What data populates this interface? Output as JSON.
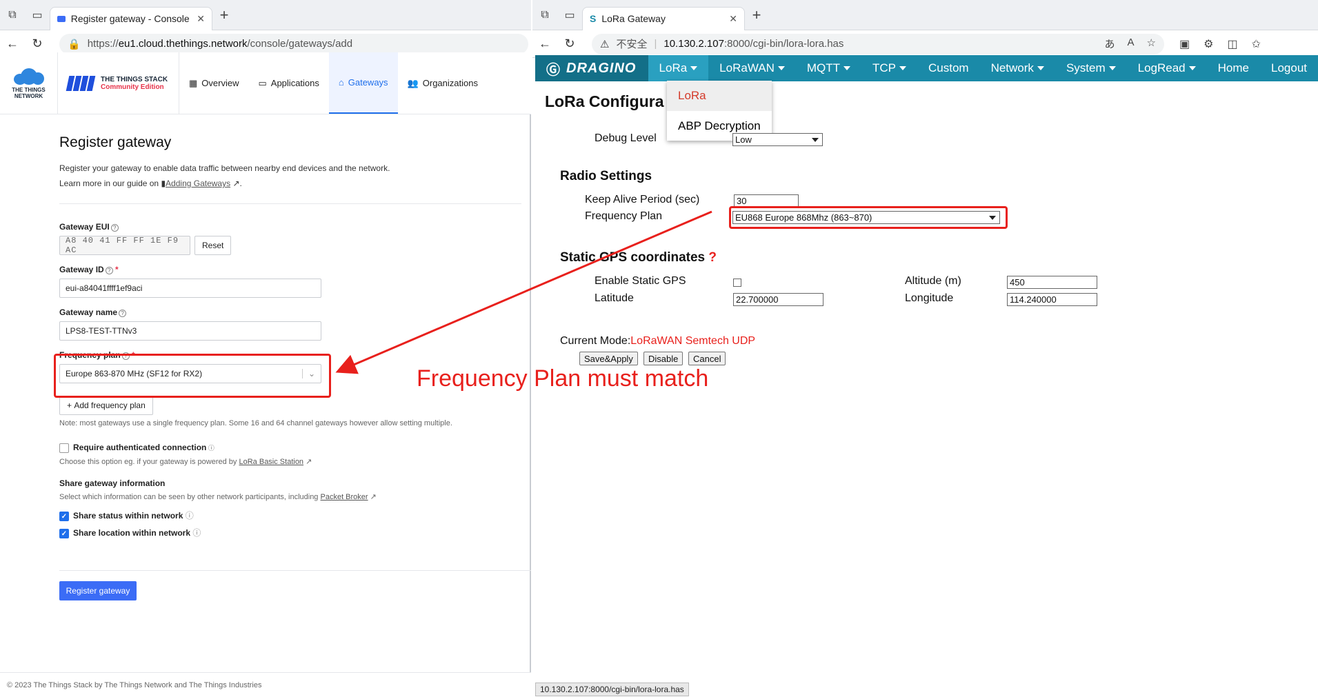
{
  "left_browser": {
    "tab_title": "Register gateway - Console - The",
    "url_prefix": "https://",
    "url_host": "eu1.cloud.thethings.network",
    "url_path": "/console/gateways/add"
  },
  "ttn": {
    "logo_text": "THE THINGS NETWORK",
    "stack_title": "THE THINGS STACK",
    "stack_edition": "Community Edition",
    "nav": [
      "Overview",
      "Applications",
      "Gateways",
      "Organizations"
    ],
    "page_title": "Register gateway",
    "intro": "Register your gateway to enable data traffic between nearby end devices and the network.",
    "learn_more": "Learn more in our guide on",
    "guide_link": "Adding Gateways",
    "eui_label": "Gateway EUI",
    "eui_value": "A8 40 41 FF FF 1E F9 AC",
    "reset_label": "Reset",
    "id_label": "Gateway ID",
    "id_value": "eui-a84041ffff1ef9aci",
    "name_label": "Gateway name",
    "name_value": "LPS8-TEST-TTNv3",
    "freq_label": "Frequency plan",
    "freq_value": "Europe 863-870 MHz (SF12 for RX2)",
    "add_freq": "Add frequency plan",
    "freq_note": "Note: most gateways use a single frequency plan. Some 16 and 64 channel gateways however allow setting multiple.",
    "auth_label": "Require authenticated connection",
    "auth_note": "Choose this option eg. if your gateway is powered by",
    "auth_link": "LoRa Basic Station",
    "share_title": "Share gateway information",
    "share_note": "Select which information can be seen by other network participants, including",
    "share_link": "Packet Broker",
    "share_status": "Share status within network",
    "share_location": "Share location within network",
    "register_button": "Register gateway",
    "footer": "© 2023 The Things Stack by The Things Network and The Things Industries"
  },
  "right_browser": {
    "tab_title": "LoRa Gateway",
    "insecure": "不安全",
    "url_host": "10.130.2.107",
    "url_rest": ":8000/cgi-bin/lora-lora.has",
    "status_url": "10.130.2.107:8000/cgi-bin/lora-lora.has"
  },
  "dragino": {
    "brand": "DRAGINO",
    "menu": [
      "LoRa",
      "LoRaWAN",
      "MQTT",
      "TCP",
      "Custom",
      "Network",
      "System",
      "LogRead",
      "Home",
      "Logout"
    ],
    "dropdown": [
      "LoRa",
      "ABP Decryption"
    ],
    "page_title": "LoRa Configura",
    "debug_label": "Debug Level",
    "debug_value": "Low",
    "radio_title": "Radio Settings",
    "keepalive_label": "Keep Alive Period (sec)",
    "keepalive_value": "30",
    "freqplan_label": "Frequency Plan",
    "freqplan_value": "EU868 Europe 868Mhz (863~870)",
    "gps_title": "Static GPS coordinates",
    "gps_help": "?",
    "static_gps_label": "Enable Static GPS",
    "altitude_label": "Altitude (m)",
    "altitude_value": "450",
    "latitude_label": "Latitude",
    "latitude_value": "22.700000",
    "longitude_label": "Longitude",
    "longitude_value": "114.240000",
    "mode_label": "Current Mode:",
    "mode_value": "LoRaWAN Semtech UDP",
    "save_label": "Save&Apply",
    "disable_label": "Disable",
    "cancel_label": "Cancel"
  },
  "annotation": {
    "text": "Frequency Plan must match"
  },
  "colors": {
    "ttn_blue": "#3b6cf6",
    "dragino_teal": "#1a8aa8",
    "annotation_red": "#e8201c"
  }
}
